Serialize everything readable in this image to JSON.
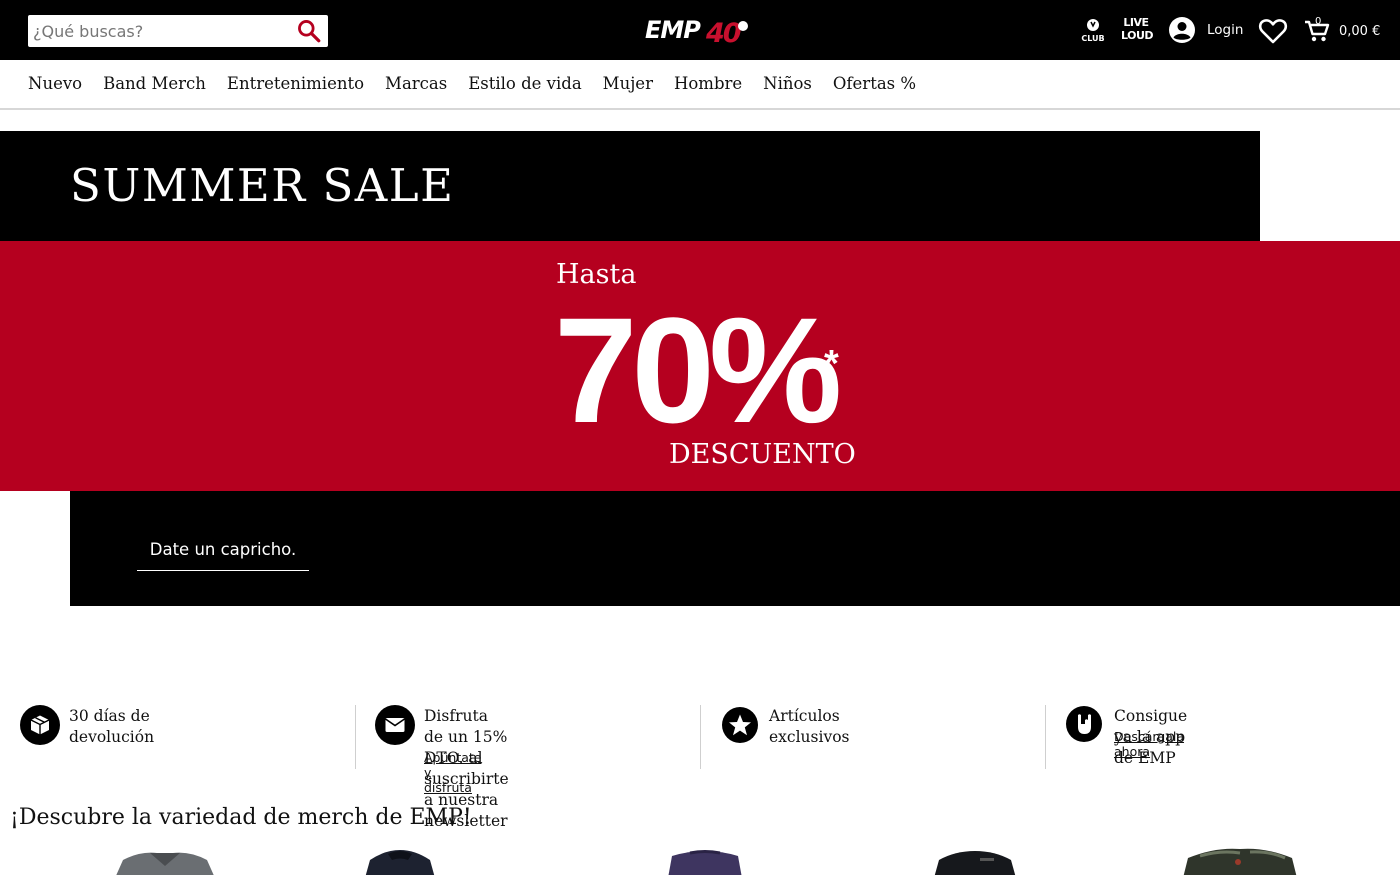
{
  "header": {
    "search_placeholder": "¿Qué buscas?",
    "logo_text": "EMP40",
    "club_label": "CLUB",
    "liveloud_label_1": "LIVE",
    "liveloud_label_2": "LOUD",
    "login_label": "Login",
    "cart_count": "0",
    "cart_total": "0,00 €"
  },
  "nav": {
    "items": [
      "Nuevo",
      "Band Merch",
      "Entretenimiento",
      "Marcas",
      "Estilo de vida",
      "Mujer",
      "Hombre",
      "Niños",
      "Ofertas %"
    ]
  },
  "banner": {
    "title": "SUMMER SALE",
    "hasta": "Hasta",
    "percent": "70%",
    "asterisk": "*",
    "descuento": "DESCUENTO",
    "cta": "Date un capricho."
  },
  "usps": [
    {
      "text": "30 días de devolución",
      "link": "",
      "icon": "return-box-icon"
    },
    {
      "text_line1": "Disfruta de un 15% DTO. al",
      "text_line2": "suscribirte a nuestra newsletter",
      "link": "Apúntate y disfruta",
      "icon": "mail-icon"
    },
    {
      "text": "Artículos exclusivos",
      "link": "",
      "icon": "star-icon"
    },
    {
      "text": "Consigue ya la app de EMP",
      "link": "Descárgala ahora",
      "icon": "rock-hand-icon"
    }
  ],
  "discover_title": "¡Descubre la variedad de merch de EMP!",
  "colors": {
    "header_bg": "#000000",
    "sale_red": "#b5001f",
    "logo_red": "#c8102e"
  }
}
